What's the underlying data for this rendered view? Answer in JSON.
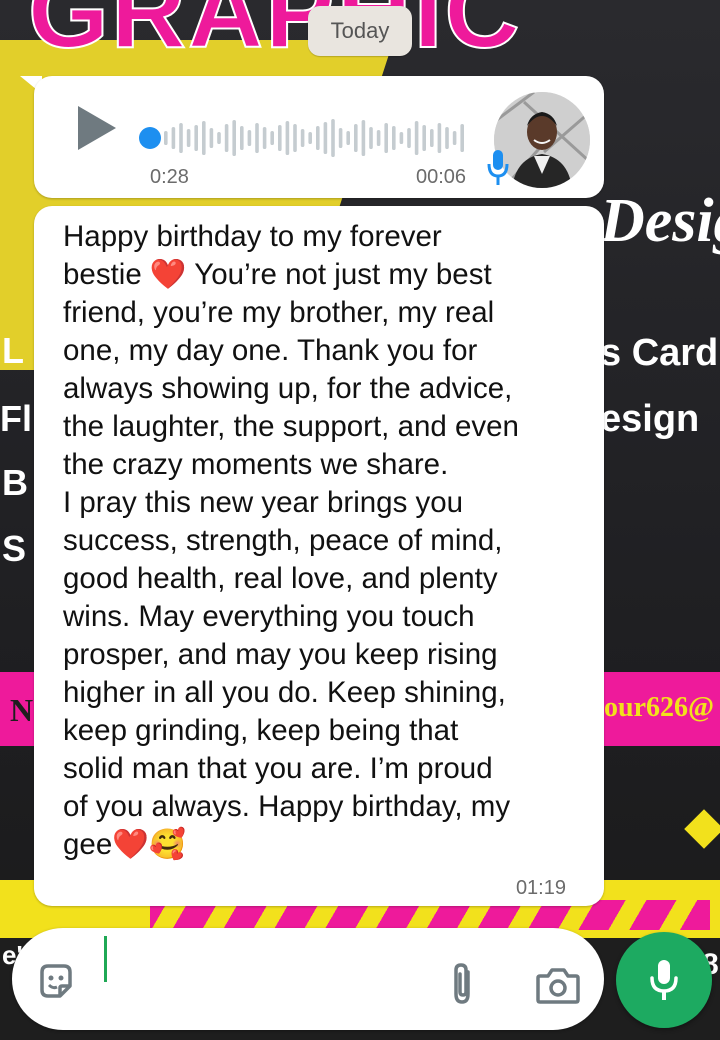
{
  "background": {
    "title": "GRAPHIC",
    "word_designs": "Designes",
    "word_cards": "s Card",
    "word_design": "esign",
    "email_fragment": "our626@",
    "left_letters": [
      "L",
      "Fl",
      "B",
      "S"
    ],
    "letter_n": "N",
    "edge_chars": [
      "e'",
      "8"
    ],
    "colors": {
      "yellow": "#f2e11c",
      "pink": "#ee1a9b",
      "dark": "#1e1e1e"
    }
  },
  "chat": {
    "date_label": "Today",
    "voice_message": {
      "duration": "0:28",
      "time": "00:06",
      "play_icon": "play-icon",
      "progress": 0,
      "avatar_icon": "avatar",
      "mic_icon": "mic-icon"
    },
    "text_message": {
      "body": "Happy birthday to my forever\nbestie ❤️ You’re not just my best\nfriend, you’re my brother, my real\none, my day one. Thank you for\nalways showing up, for the advice,\nthe laughter, the support, and even\nthe crazy moments we share.\nI pray this new year brings you\nsuccess, strength, peace of mind,\ngood health, real love, and plenty\nwins. May everything you touch\nprosper, and may you keep rising\nhigher in all you do. Keep shining,\nkeep grinding, keep being that\nsolid man that you are. I’m proud\nof you always. Happy birthday, my\ngee❤️🥰",
      "time": "01:19"
    }
  },
  "composer": {
    "input_value": "",
    "icons": {
      "sticker": "sticker-icon",
      "attach": "paperclip-icon",
      "camera": "camera-icon",
      "send": "mic-icon"
    },
    "accent": "#1daa61"
  }
}
